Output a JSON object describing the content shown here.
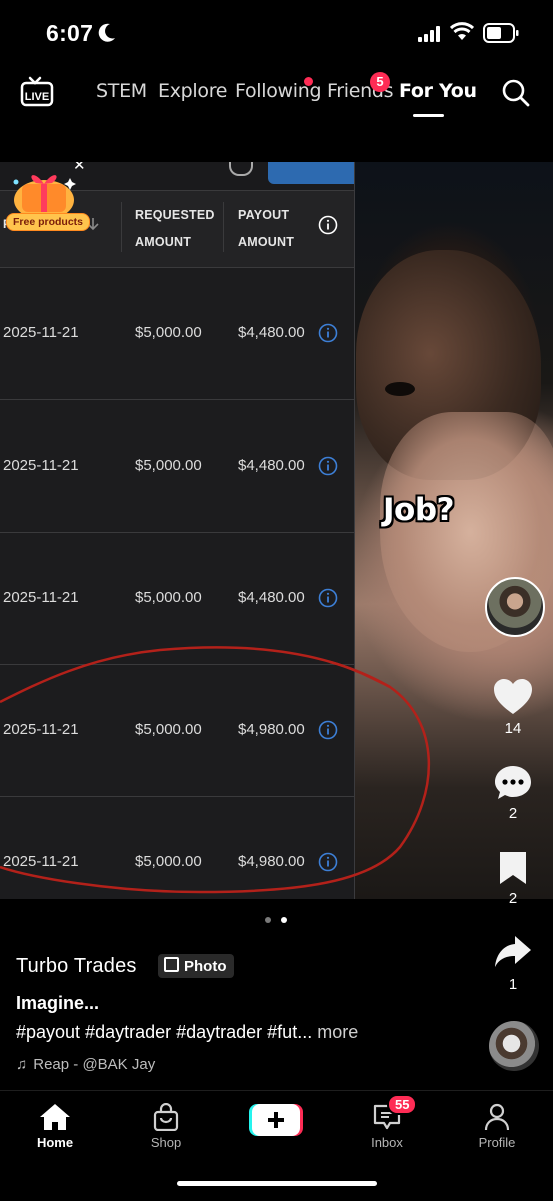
{
  "status_bar": {
    "time": "6:07"
  },
  "top_nav": {
    "live_label": "LIVE",
    "tabs": [
      "STEM",
      "Explore",
      "Following",
      "Friends",
      "For You"
    ],
    "active_tab": "For You",
    "friends_badge": "5"
  },
  "post_media": {
    "overlay_text": "Job?",
    "promo_badge": "Free products",
    "table": {
      "headers": {
        "requested_line1": "REQUESTED",
        "requested_line2": "AMOUNT",
        "payout_line1": "PAYOUT",
        "payout_line2": "AMOUNT",
        "partial": "P"
      },
      "rows": [
        {
          "date": "2025-11-21",
          "requested": "$5,000.00",
          "payout": "$4,480.00"
        },
        {
          "date": "2025-11-21",
          "requested": "$5,000.00",
          "payout": "$4,480.00"
        },
        {
          "date": "2025-11-21",
          "requested": "$5,000.00",
          "payout": "$4,480.00"
        },
        {
          "date": "2025-11-21",
          "requested": "$5,000.00",
          "payout": "$4,980.00"
        },
        {
          "date": "2025-11-21",
          "requested": "$5,000.00",
          "payout": "$4,980.00"
        }
      ]
    },
    "annotation_color": "#b3211a",
    "pager": {
      "total": 2,
      "current": 2
    }
  },
  "actions": {
    "likes": "14",
    "comments": "2",
    "saves": "2",
    "shares": "1"
  },
  "caption": {
    "username": "Turbo Trades",
    "type_badge": "Photo",
    "title": "Imagine...",
    "hashtags": "#payout #daytrader #daytrader #fut...",
    "more_label": " more",
    "sound": "Reap - @BAK Jay"
  },
  "bottom_nav": {
    "home": "Home",
    "shop": "Shop",
    "inbox": "Inbox",
    "inbox_badge": "55",
    "profile": "Profile"
  },
  "colors": {
    "accent_red": "#fe2c55",
    "accent_cyan": "#25f4ee",
    "info_blue": "#3d7fd6",
    "panel_bg": "#1c1c1e"
  }
}
